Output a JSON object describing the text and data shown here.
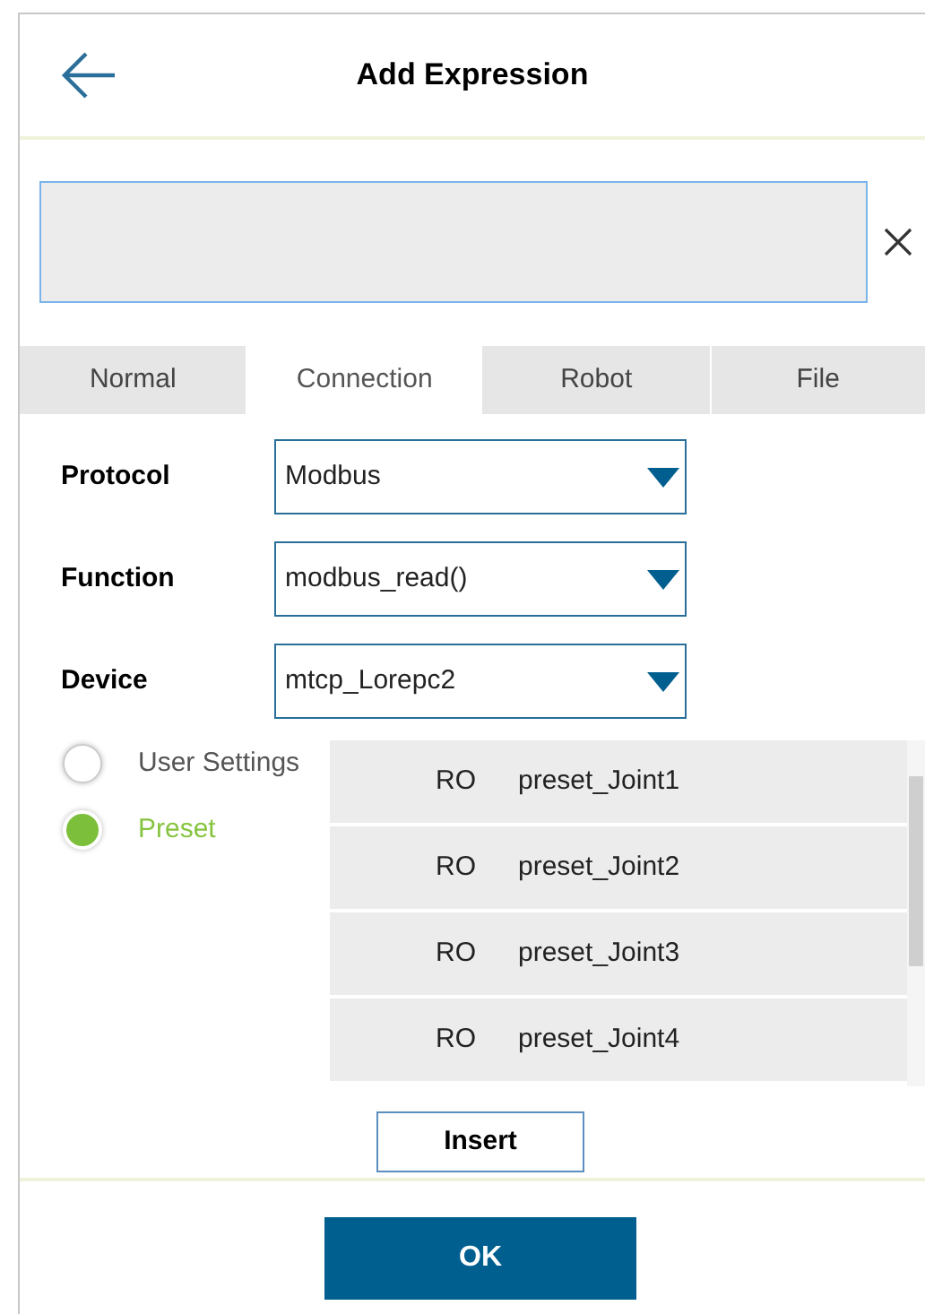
{
  "header": {
    "title": "Add Expression"
  },
  "tabs": [
    {
      "label": "Normal",
      "selected": false
    },
    {
      "label": "Connection",
      "selected": true
    },
    {
      "label": "Robot",
      "selected": false
    },
    {
      "label": "File",
      "selected": false
    }
  ],
  "fields": [
    {
      "label": "Protocol",
      "value": "Modbus"
    },
    {
      "label": "Function",
      "value": "modbus_read()"
    },
    {
      "label": "Device",
      "value": "mtcp_Lorepc2"
    }
  ],
  "source_options": [
    {
      "label": "User Settings",
      "selected": false
    },
    {
      "label": "Preset",
      "selected": true
    }
  ],
  "presets": [
    {
      "access": "RO",
      "name": "preset_Joint1"
    },
    {
      "access": "RO",
      "name": "preset_Joint2"
    },
    {
      "access": "RO",
      "name": "preset_Joint3"
    },
    {
      "access": "RO",
      "name": "preset_Joint4"
    }
  ],
  "insert_button": "Insert",
  "ok_button": "OK"
}
